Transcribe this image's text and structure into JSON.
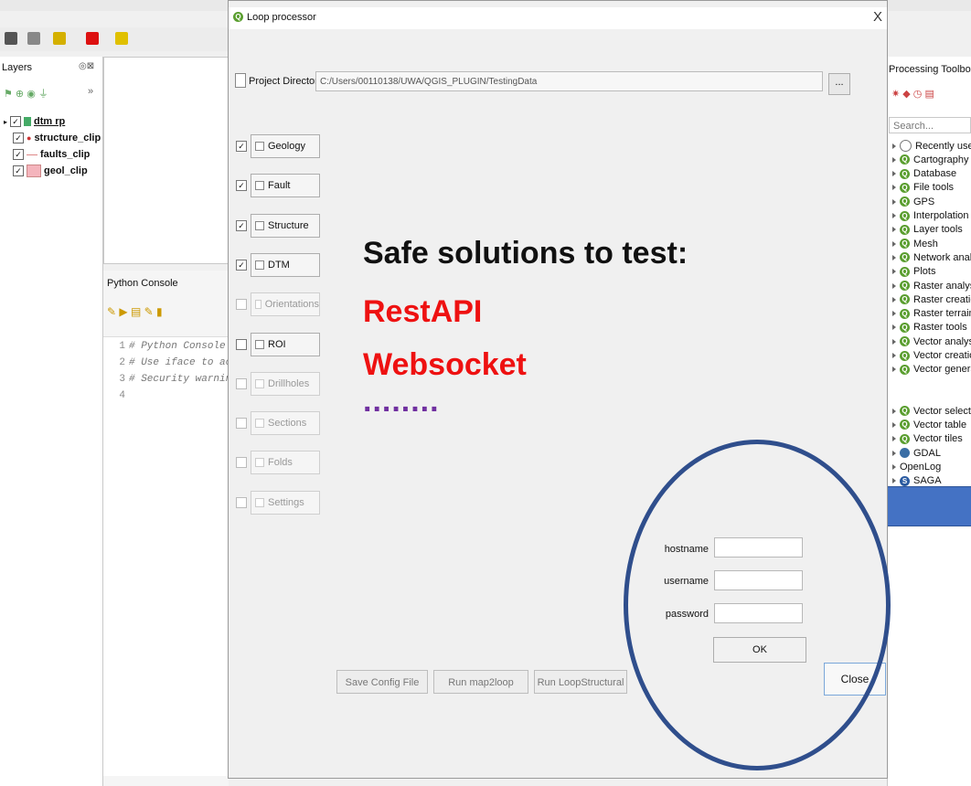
{
  "qgis": {
    "layers_title": "Layers",
    "layers": [
      {
        "name": "dtm rp",
        "top": 0
      },
      {
        "name": "structure_clip"
      },
      {
        "name": "faults_clip"
      },
      {
        "name": "geol_clip"
      }
    ],
    "python_console": {
      "title": "Python Console",
      "lines": [
        {
          "num": "1",
          "text": "# Python Console"
        },
        {
          "num": "2",
          "text": "# Use iface to acce"
        },
        {
          "num": "3",
          "text": "# Security warning"
        },
        {
          "num": "4",
          "text": ""
        }
      ]
    },
    "processing": {
      "title": "Processing Toolbox",
      "search_placeholder": "Search...",
      "items": [
        "Recently used",
        "Cartography",
        "Database",
        "File tools",
        "GPS",
        "Interpolation",
        "Layer tools",
        "Mesh",
        "Network analy",
        "Plots",
        "Raster analysis",
        "Raster creation",
        "Raster terrain a",
        "Raster tools",
        "Vector analysis",
        "Vector creation",
        "Vector general",
        "Vector selectio",
        "Vector table",
        "Vector tiles",
        "GDAL",
        "OpenLog",
        "SAGA"
      ]
    }
  },
  "dialog": {
    "title": "Loop processor",
    "close_glyph": "X",
    "project_dir_label": "Project Directory",
    "project_dir_value": "C:/Users/00110138/UWA/QGIS_PLUGIN/TestingData",
    "browse_label": "...",
    "sections": [
      {
        "label": "Geology",
        "checked": true,
        "enabled": true
      },
      {
        "label": "Fault",
        "checked": true,
        "enabled": true
      },
      {
        "label": "Structure",
        "checked": true,
        "enabled": true
      },
      {
        "label": "DTM",
        "checked": true,
        "enabled": true
      },
      {
        "label": "Orientations",
        "checked": false,
        "enabled": false
      },
      {
        "label": "ROI",
        "checked": false,
        "enabled": true
      },
      {
        "label": "Drillholes",
        "checked": false,
        "enabled": false
      },
      {
        "label": "Sections",
        "checked": false,
        "enabled": false
      },
      {
        "label": "Folds",
        "checked": false,
        "enabled": false
      },
      {
        "label": "Settings",
        "checked": false,
        "enabled": false
      }
    ],
    "buttons": {
      "save_config": "Save Config File",
      "run_map2loop": "Run map2loop",
      "run_loopstructural": "Run LoopStructural",
      "close": "Close"
    }
  },
  "overlay": {
    "headline": "Safe solutions to test:",
    "option1": "RestAPI",
    "option2": "Websocket",
    "ellipsis": "........"
  },
  "login": {
    "hostname_label": "hostname",
    "username_label": "username",
    "password_label": "password",
    "ok_label": "OK"
  },
  "colors": {
    "accent_red": "#ee1111",
    "dots_purple": "#7030a0",
    "circle_blue": "#2f4e8c",
    "bar_blue": "#4472c4",
    "qgis_green": "#5a9e2f"
  }
}
